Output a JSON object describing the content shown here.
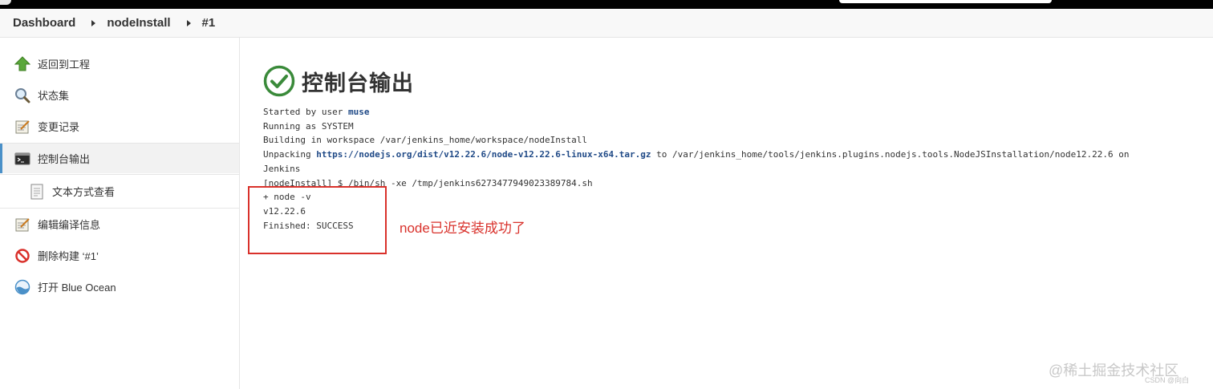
{
  "breadcrumb": {
    "items": [
      "Dashboard",
      "nodeInstall",
      "#1"
    ]
  },
  "sidebar": {
    "items": [
      {
        "label": "返回到工程",
        "icon": "up-arrow-icon"
      },
      {
        "label": "状态集",
        "icon": "search-icon"
      },
      {
        "label": "变更记录",
        "icon": "notepad-icon"
      },
      {
        "label": "控制台输出",
        "icon": "terminal-icon"
      },
      {
        "label": "文本方式查看",
        "icon": "document-icon"
      },
      {
        "label": "编辑编译信息",
        "icon": "notepad-icon"
      },
      {
        "label": "删除构建 ‘#1’",
        "icon": "delete-icon"
      },
      {
        "label": "打开 Blue Ocean",
        "icon": "blue-ocean-icon"
      }
    ]
  },
  "main": {
    "title": "控制台输出",
    "status_icon": "success-check-icon",
    "console": {
      "line1_prefix": "Started by user ",
      "line1_user": "muse",
      "line2": "Running as SYSTEM",
      "line3": "Building in workspace /var/jenkins_home/workspace/nodeInstall",
      "line4_prefix": "Unpacking ",
      "line4_link": "https://nodejs.org/dist/v12.22.6/node-v12.22.6-linux-x64.tar.gz",
      "line4_suffix": " to /var/jenkins_home/tools/jenkins.plugins.nodejs.tools.NodeJSInstallation/node12.22.6 on",
      "line5": "Jenkins",
      "line6": "[nodeInstall] $ /bin/sh -xe /tmp/jenkins6273477949023389784.sh",
      "line7": "+ node -v",
      "line8": "v12.22.6",
      "line9": "Finished: SUCCESS"
    },
    "annotation": "node已近安装成功了"
  },
  "watermark": {
    "text": "@稀土掘金技术社区",
    "sub": "CSDN @向白"
  },
  "colors": {
    "accent": "#4a90c8",
    "annotation_red": "#d9312b",
    "link": "#204a87",
    "success_green": "#3a8a3a"
  }
}
